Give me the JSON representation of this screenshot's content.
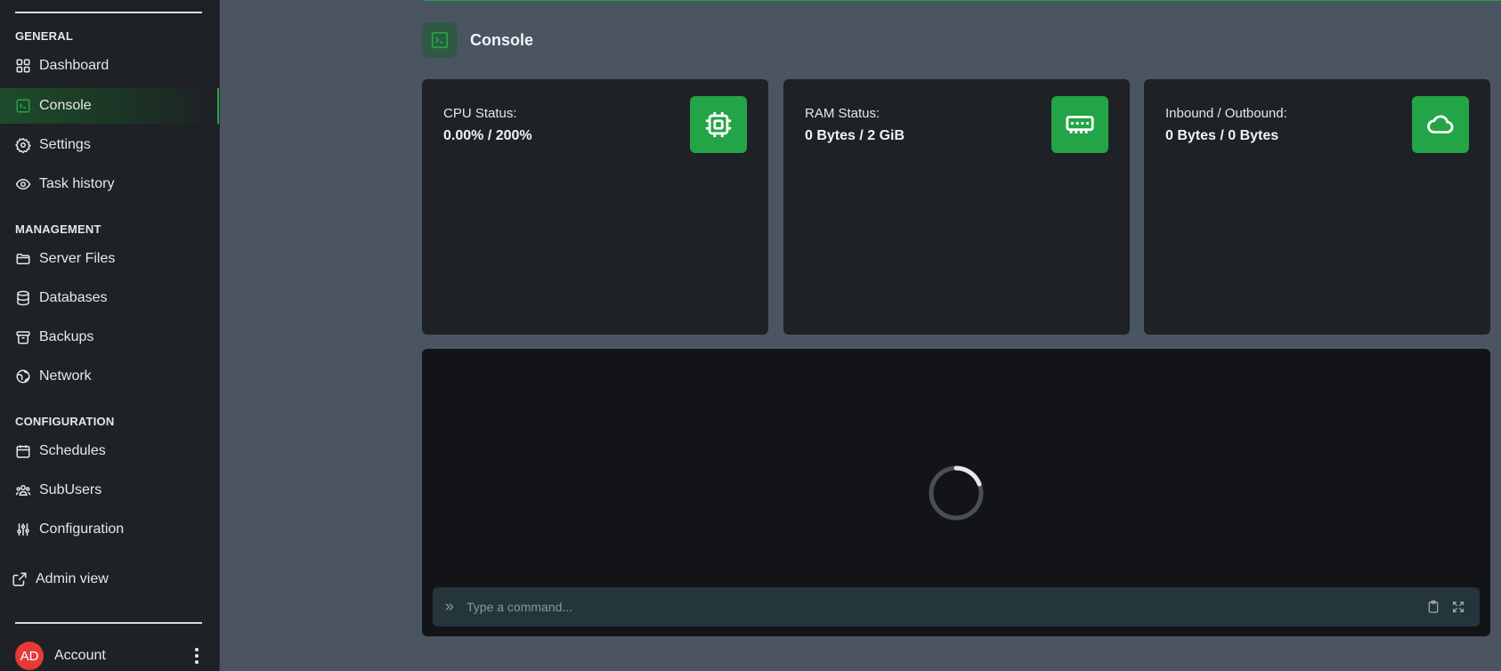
{
  "sidebar": {
    "sections": {
      "general": "GENERAL",
      "management": "MANAGEMENT",
      "configuration": "CONFIGURATION"
    },
    "items": [
      {
        "label": "Dashboard",
        "icon": "grid-icon"
      },
      {
        "label": "Console",
        "icon": "terminal-icon",
        "active": true
      },
      {
        "label": "Settings",
        "icon": "gear-icon"
      },
      {
        "label": "Task history",
        "icon": "eye-icon"
      },
      {
        "label": "Server Files",
        "icon": "folder-icon"
      },
      {
        "label": "Databases",
        "icon": "database-icon"
      },
      {
        "label": "Backups",
        "icon": "archive-icon"
      },
      {
        "label": "Network",
        "icon": "globe-icon"
      },
      {
        "label": "Schedules",
        "icon": "calendar-icon"
      },
      {
        "label": "SubUsers",
        "icon": "users-icon"
      },
      {
        "label": "Configuration",
        "icon": "sliders-icon"
      },
      {
        "label": "Admin view",
        "icon": "external-link-icon"
      }
    ],
    "account": {
      "initials": "AD",
      "label": "Account"
    }
  },
  "page": {
    "title": "Console"
  },
  "stats": [
    {
      "label": "CPU Status:",
      "value": "0.00% / 200%",
      "icon": "cpu-icon"
    },
    {
      "label": "RAM Status:",
      "value": "0 Bytes / 2 GiB",
      "icon": "memory-icon"
    },
    {
      "label": "Inbound / Outbound:",
      "value": "0 Bytes / 0 Bytes",
      "icon": "cloud-icon"
    }
  ],
  "console": {
    "placeholder": "Type a command...",
    "loading": true
  },
  "colors": {
    "accent": "#22a447",
    "background": "#4a5561",
    "sidebar": "#1e2125",
    "card": "#1e2125",
    "console": "#121417",
    "avatar": "#e53a3a"
  }
}
